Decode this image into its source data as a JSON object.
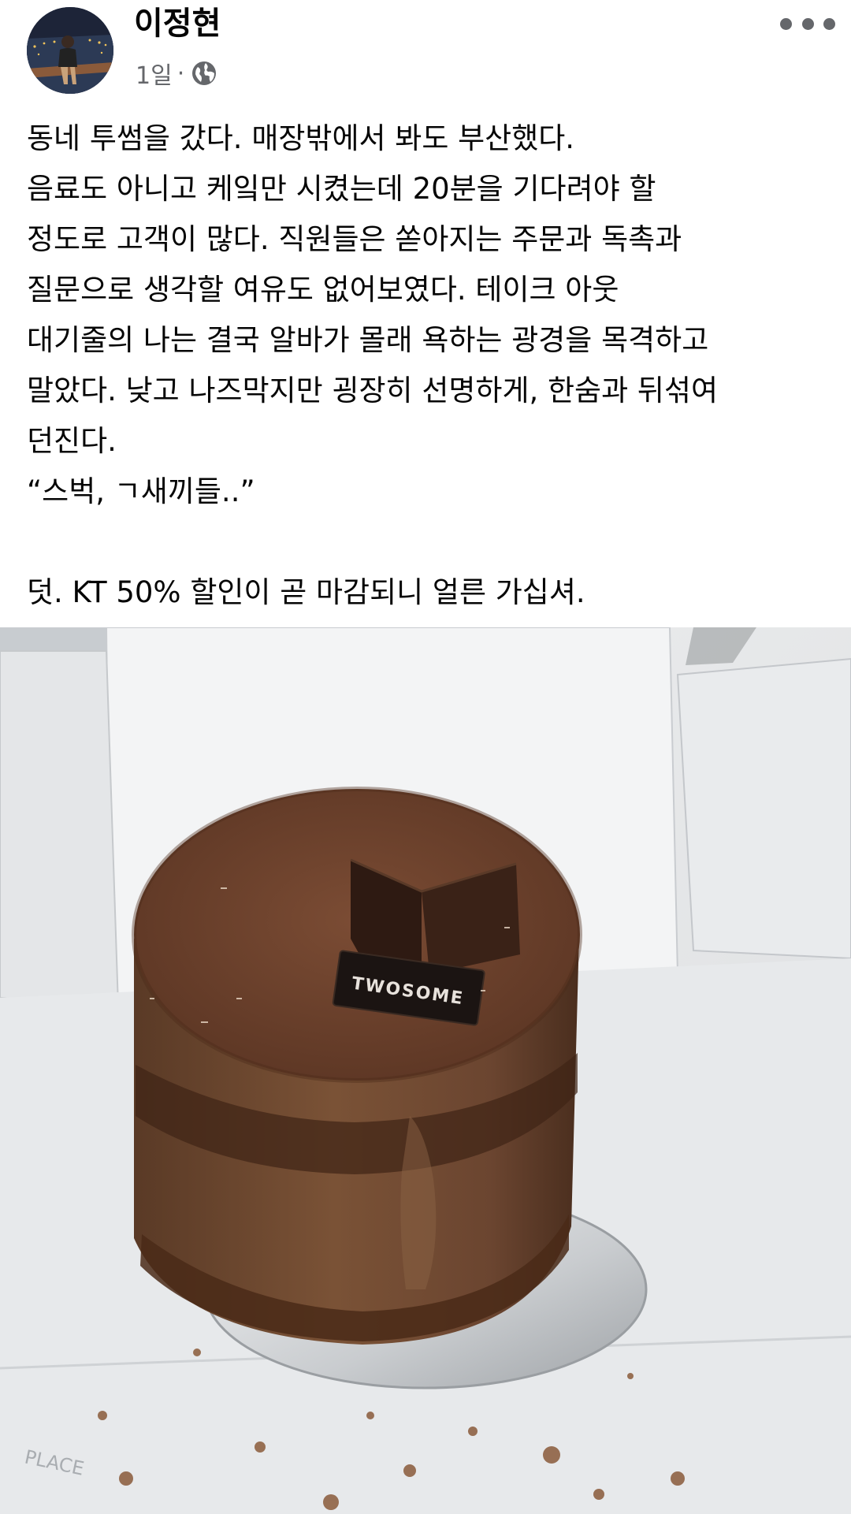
{
  "post": {
    "author_name": "이정현",
    "time": "1일",
    "separator": "·",
    "privacy_icon": "globe-icon",
    "more_icon": "more-options-icon",
    "lines": [
      "동네 투썸을 갔다. 매장밖에서 봐도 부산했다.",
      "음료도 아니고 케잌만 시켰는데 20분을 기다려야 할",
      "정도로 고객이 많다. 직원들은 쏟아지는 주문과 독촉과",
      "질문으로 생각할 여유도 없어보였다. 테이크 아웃",
      "대기줄의 나는 결국 알바가 몰래 욕하는 광경을 목격하고",
      "말았다. 낮고 나즈막지만 굉장히 선명하게, 한숨과 뒤섞여",
      "던진다.",
      "“스벅, ㄱ새끼들..”",
      "",
      "덧. KT 50% 할인이 곧 마감되니 얼른 가십셔."
    ]
  },
  "photo": {
    "plaque_text": "TWOSOME",
    "box_print_text": "PLACE"
  },
  "colors": {
    "text_primary": "#050505",
    "text_secondary": "#65676b",
    "background": "#ffffff"
  }
}
